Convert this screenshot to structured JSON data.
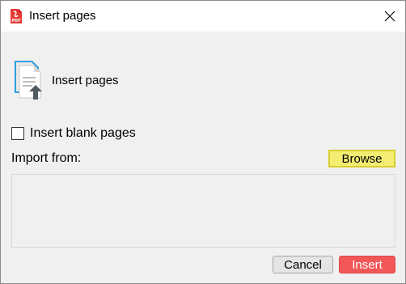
{
  "window": {
    "title": "Insert pages",
    "app_icon": "pdf-app-icon",
    "app_icon_text": "PDF",
    "close_icon": "close-icon"
  },
  "header": {
    "icon": "insert-pages-icon",
    "title": "Insert pages"
  },
  "options": {
    "blank_pages_label": "Insert blank pages",
    "blank_pages_checked": false
  },
  "import": {
    "label": "Import from:",
    "browse_label": "Browse",
    "file_list": []
  },
  "footer": {
    "cancel_label": "Cancel",
    "insert_label": "Insert"
  },
  "colors": {
    "browse_highlight": "#f3ee73",
    "insert_button": "#f25757",
    "app_icon_red": "#e53935"
  }
}
